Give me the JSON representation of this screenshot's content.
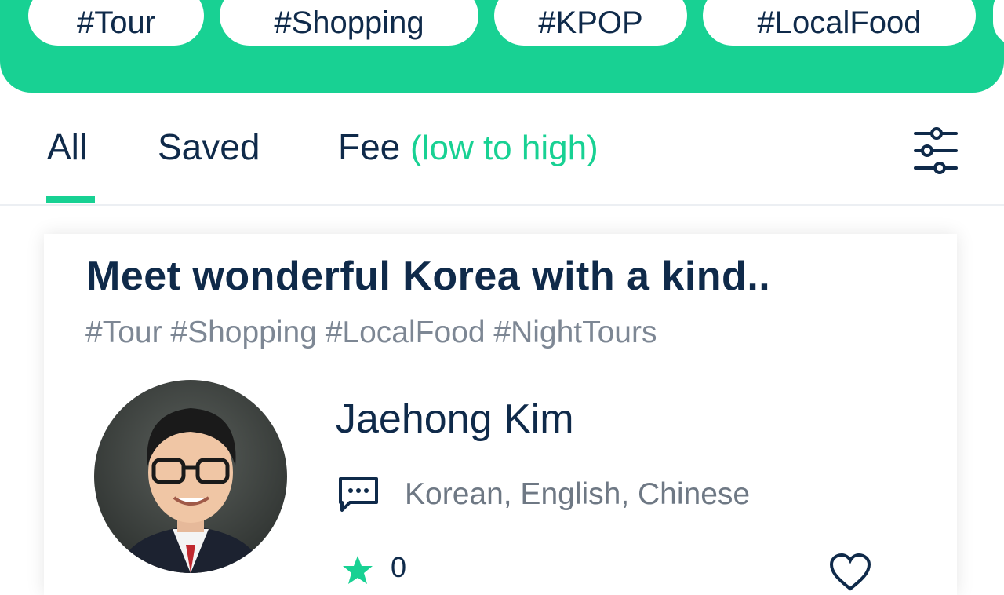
{
  "hashtags": [
    "#Tour",
    "#Shopping",
    "#KPOP",
    "#LocalFood"
  ],
  "tabs": {
    "all": "All",
    "saved": "Saved",
    "fee": "Fee",
    "fee_note": "(low to high)"
  },
  "card": {
    "title": "Meet wonderful Korea with a kind..",
    "tags": "#Tour #Shopping #LocalFood #NightTours",
    "guide_name": "Jaehong Kim",
    "languages": "Korean, English, Chinese",
    "rating": "0"
  },
  "colors": {
    "accent": "#18d193",
    "text_dark": "#0f2a4a",
    "text_muted": "#7d8794"
  },
  "icons": {
    "filter": "sliders-icon",
    "languages": "chat-bubble-icon",
    "rating": "star-icon",
    "save": "heart-icon"
  }
}
